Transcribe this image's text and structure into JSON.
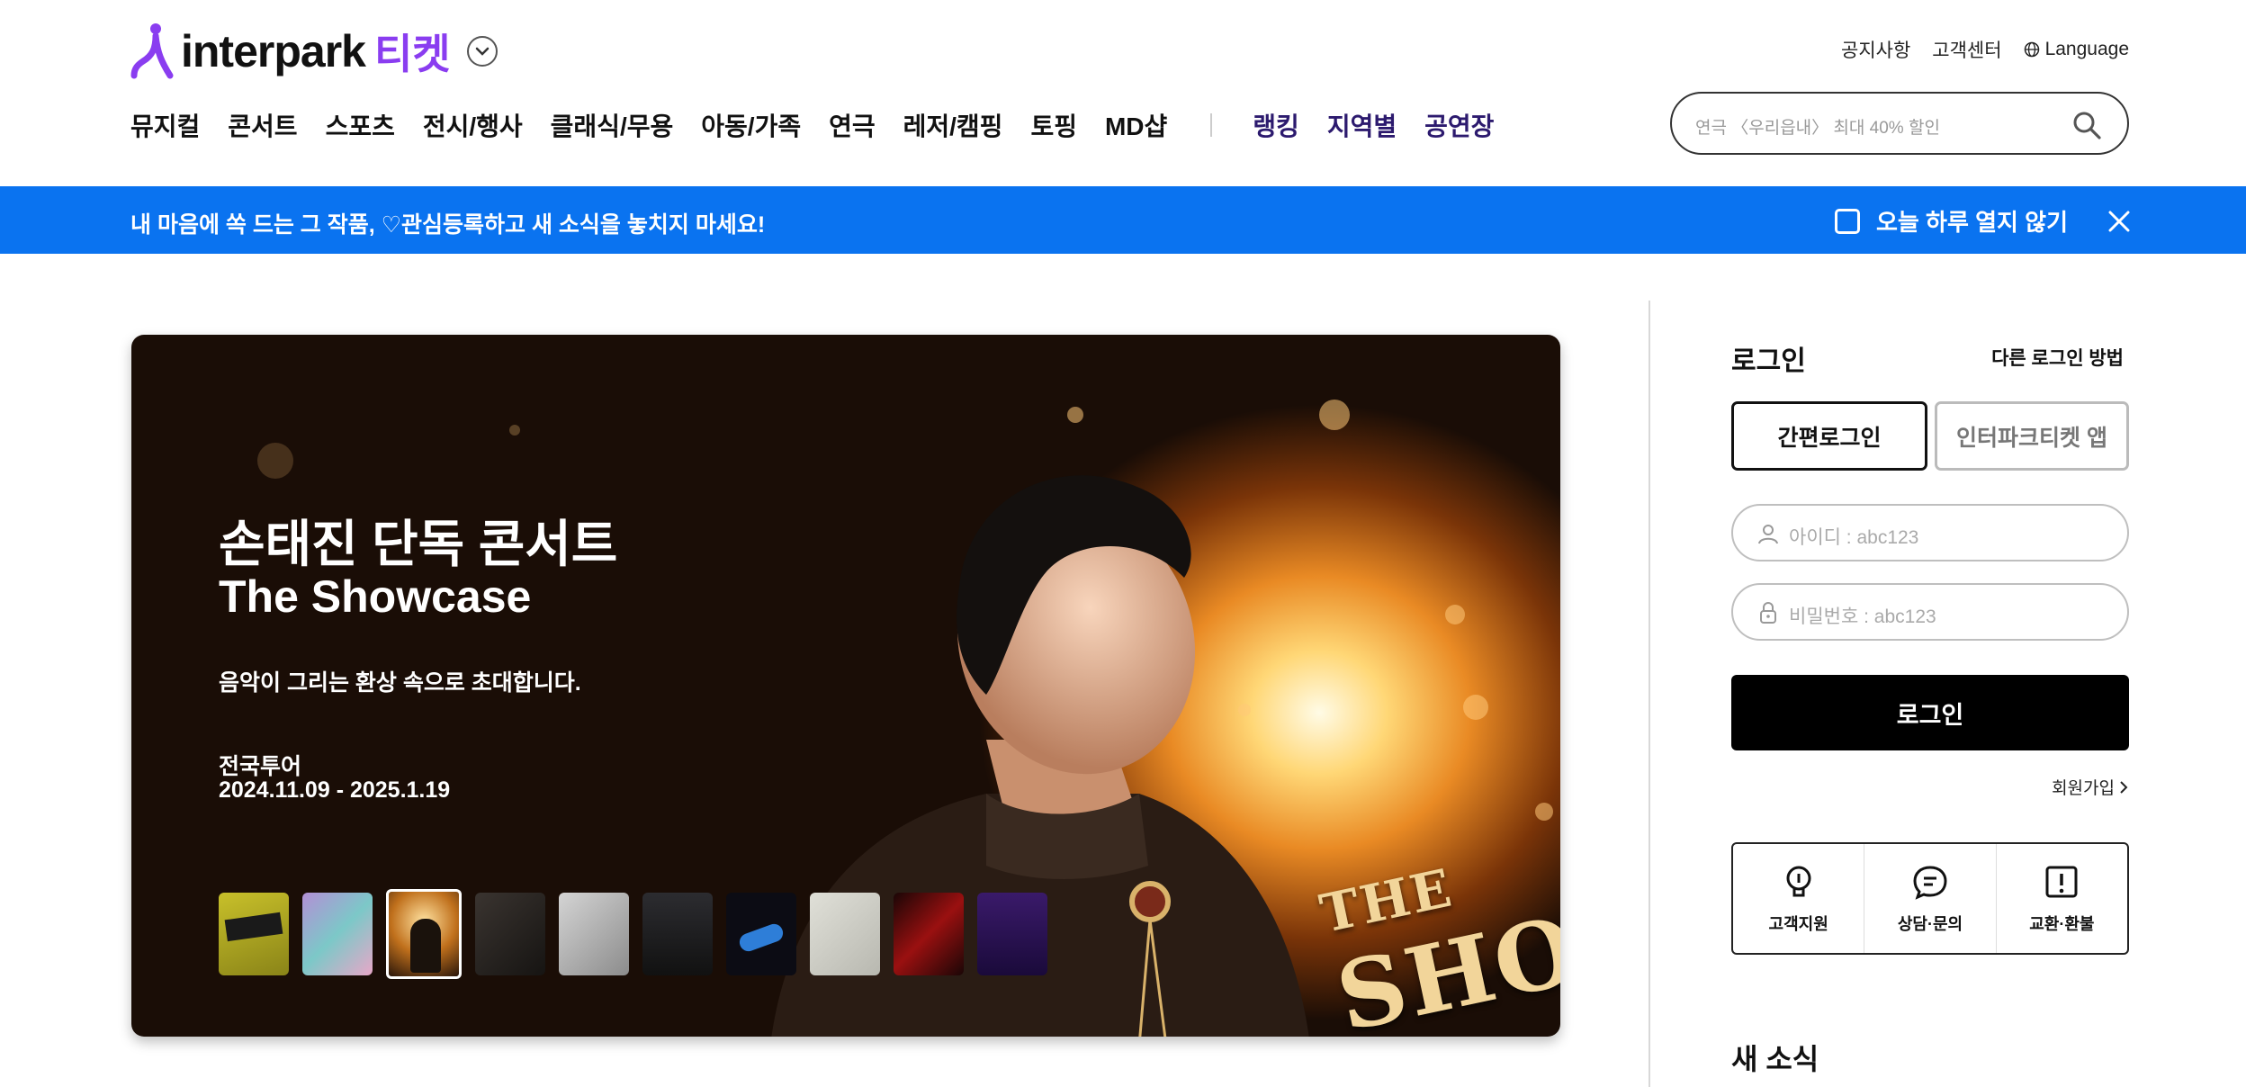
{
  "header": {
    "logo_word": "interpark",
    "logo_ticket": "티켓",
    "util_links": [
      "공지사항",
      "고객센터"
    ],
    "language_label": "Language",
    "nav_items": [
      "뮤지컬",
      "콘서트",
      "스포츠",
      "전시/행사",
      "클래식/무용",
      "아동/가족",
      "연극",
      "레저/캠핑",
      "토핑",
      "MD샵"
    ],
    "nav_accent_items": [
      "랭킹",
      "지역별",
      "공연장"
    ],
    "search_placeholder": "연극 〈우리읍내〉 최대 40% 할인"
  },
  "notice": {
    "message": "내 마음에 쏙 드는 그 작품, ♡관심등록하고 새 소식을 놓치지 마세요!",
    "dismiss_label": "오늘 하루 열지 않기",
    "color": "#0a73f0"
  },
  "hero": {
    "title_ko": "손태진 단독 콘서트",
    "title_en": "The Showcase",
    "subtitle": "음악이 그리는 환상 속으로 초대합니다.",
    "tour_label": "전국투어",
    "date_range": "2024.11.09 - 2025.1.19",
    "brand_line1": "THE",
    "brand_line2": "SHOWC",
    "thumbnails": [
      "boom",
      "clover",
      "showcase",
      "dark-man",
      "white-sculpture",
      "swing-days",
      "blue-car",
      "letters",
      "red-poster",
      "aladdin"
    ],
    "active_thumbnail": 3
  },
  "login": {
    "title": "로그인",
    "other_methods": "다른 로그인 방법",
    "tab_easy": "간편로그인",
    "tab_app": "인터파크티켓 앱",
    "id_placeholder": "아이디 : abc123",
    "pw_placeholder": "비밀번호 : abc123",
    "submit_label": "로그인",
    "join_label": "회원가입"
  },
  "support": {
    "items": [
      "고객지원",
      "상담·문의",
      "교환·환불"
    ]
  },
  "news": {
    "title": "새 소식"
  }
}
